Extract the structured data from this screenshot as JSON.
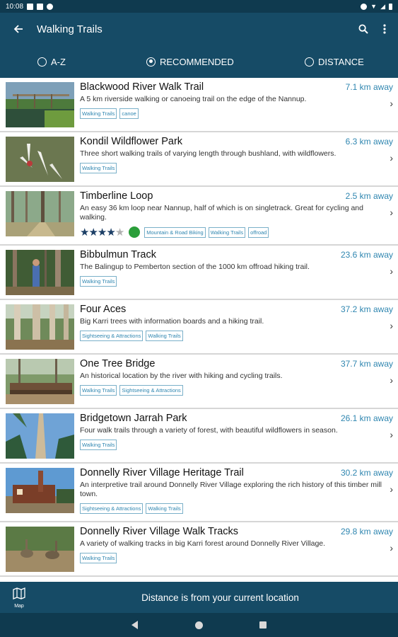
{
  "status": {
    "time": "10:08"
  },
  "app": {
    "title": "Walking Trails"
  },
  "sort_tabs": [
    {
      "label": "A-Z",
      "selected": false
    },
    {
      "label": "RECOMMENDED",
      "selected": true
    },
    {
      "label": "DISTANCE",
      "selected": false
    }
  ],
  "colors": {
    "header": "#164b66",
    "statusbar": "#0f3a4f",
    "accent": "#2f86b0",
    "rating_dot": "#2b9e3a"
  },
  "trails": [
    {
      "name": "Blackwood River Walk Trail",
      "distance": "7.1 km away",
      "description": "A 5 km riverside walking or canoeing trail on the edge of the Nannup.",
      "tags": [
        "Walking Trails",
        "canoe"
      ],
      "image": "river-bridge-photo"
    },
    {
      "name": "Kondil Wildflower Park",
      "distance": "6.3 km away",
      "description": "Three short walking trails of varying length through bushland, with wildflowers.",
      "tags": [
        "Walking Trails"
      ],
      "image": "white-orchid-photo"
    },
    {
      "name": "Timberline Loop",
      "distance": "2.5 km away",
      "description": "An easy 36 km loop near Nannup, half of which is on singletrack. Great for cycling and walking.",
      "tags": [
        "Mountain & Road Biking",
        "Walking Trails",
        "offroad"
      ],
      "rating": 3.5,
      "rating_max": 5,
      "image": "forest-trail-photo"
    },
    {
      "name": "Bibbulmun Track",
      "distance": "23.6 km away",
      "description": "The Balingup to Pemberton section of the 1000 km offroad hiking trail.",
      "tags": [
        "Walking Trails"
      ],
      "image": "hiker-forest-photo"
    },
    {
      "name": "Four Aces",
      "distance": "37.2 km away",
      "description": "Big Karri trees with information boards and a hiking trail.",
      "tags": [
        "Sightseeing & Attractions",
        "Walking Trails"
      ],
      "image": "karri-trees-photo"
    },
    {
      "name": "One Tree Bridge",
      "distance": "37.7 km away",
      "description": "An historical location by the river with hiking and cycling trails.",
      "tags": [
        "Walking Trails",
        "Sightseeing & Attractions"
      ],
      "image": "log-bridge-photo"
    },
    {
      "name": "Bridgetown Jarrah Park",
      "distance": "26.1 km away",
      "description": "Four walk trails through a variety of forest, with beautiful wildflowers in season.",
      "tags": [
        "Walking Trails"
      ],
      "image": "tall-tree-sky-photo"
    },
    {
      "name": "Donnelly River Village Heritage Trail",
      "distance": "30.2 km away",
      "description": "An interpretive trail around Donnelly River Village exploring the rich history of this timber mill town.",
      "tags": [
        "Sightseeing & Attractions",
        "Walking Trails"
      ],
      "image": "timber-mill-photo"
    },
    {
      "name": "Donnelly River Village Walk Tracks",
      "distance": "29.8 km away",
      "description": "A variety of walking tracks in big Karri forest around Donnelly River Village.",
      "tags": [
        "Walking Trails"
      ],
      "image": "emus-photo"
    }
  ],
  "bottom": {
    "map_label": "Map",
    "note": "Distance is from your current location"
  }
}
